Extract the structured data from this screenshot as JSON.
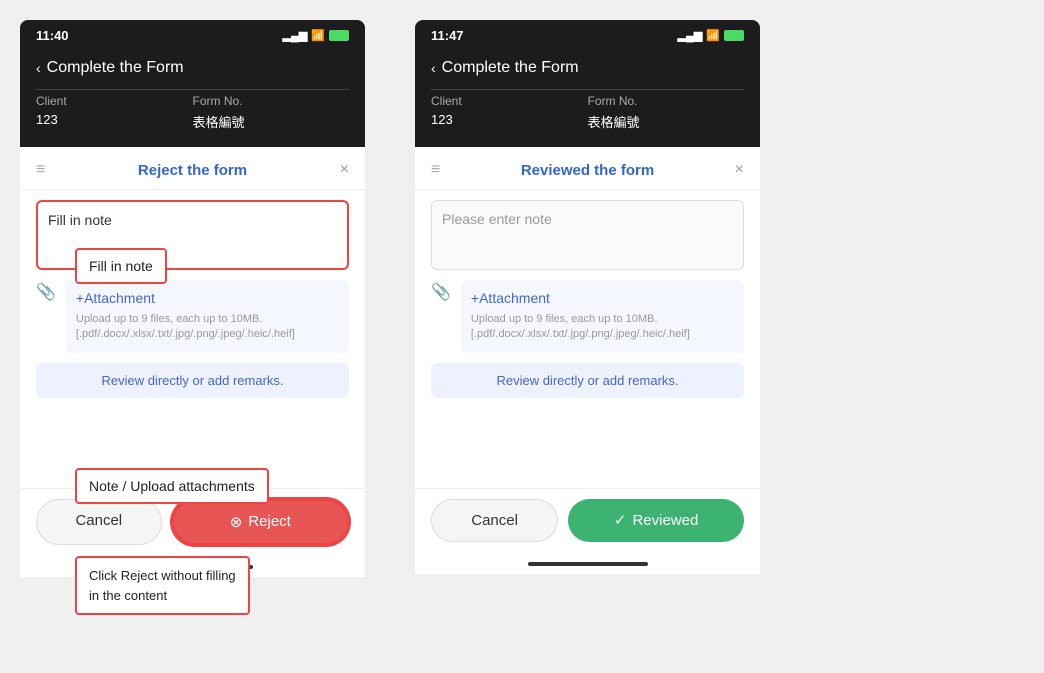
{
  "left_panel": {
    "time": "11:40",
    "signal": "▂▄▆",
    "wifi": "WiFi",
    "battery": "🔋",
    "nav_back": "‹",
    "nav_title": "Complete the Form",
    "client_label": "Client",
    "form_no_label": "Form No.",
    "client_value": "123",
    "form_no_value": "表格編號",
    "dialog_title": "Reject the form",
    "close_icon": "×",
    "note_input_text": "Fill in note",
    "attachment_btn": "+Attachment",
    "attachment_hint": "Upload up to 9 files, each up to 10MB.\n[.pdf/.docx/.xlsx/.txt/.jpg/.png/.jpeg/.heic/.heif]",
    "review_directly": "Review directly or add remarks.",
    "btn_cancel": "Cancel",
    "btn_reject": "Reject",
    "reject_circle_icon": "⊗",
    "annotation_fill": "Fill in note",
    "annotation_note_upload": "Note / Upload attachments",
    "annotation_reject": "Click Reject without filling\nin the content"
  },
  "right_panel": {
    "time": "11:47",
    "signal": "▂▄▆",
    "wifi": "WiFi",
    "battery": "🔋",
    "nav_back": "‹",
    "nav_title": "Complete the Form",
    "client_label": "Client",
    "form_no_label": "Form No.",
    "client_value": "123",
    "form_no_value": "表格編號",
    "dialog_title": "Reviewed the form",
    "close_icon": "×",
    "note_placeholder": "Please enter note",
    "attachment_btn": "+Attachment",
    "attachment_hint": "Upload up to 9 files, each up to 10MB.\n[.pdf/.docx/.xlsx/.txt/.jpg/.png/.jpeg/.heic/.heif]",
    "review_directly": "Review directly or add remarks.",
    "btn_cancel": "Cancel",
    "btn_reviewed": "Reviewed",
    "reviewed_icon": "✓"
  }
}
